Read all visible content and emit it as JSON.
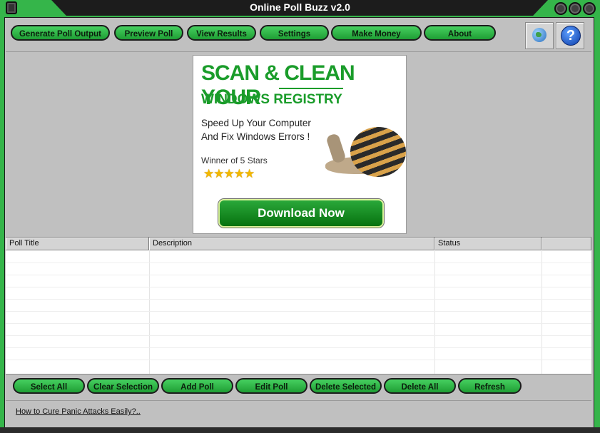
{
  "window": {
    "title": "Online Poll Buzz v2.0"
  },
  "toolbar": {
    "buttons": [
      "Generate Poll Output",
      "Preview Poll",
      "View Results",
      "Settings",
      "Make Money",
      "About"
    ],
    "icons": [
      "globe-icon",
      "help-icon"
    ]
  },
  "ad": {
    "headline": "SCAN & CLEAN YOUR",
    "subheadline": "WINDOWS REGISTRY",
    "line1": "Speed Up Your Computer",
    "line2": "And Fix Windows Errors !",
    "winner": "Winner of 5 Stars",
    "stars": "★★★★★",
    "stars_rating": 5,
    "download_label": "Download Now"
  },
  "table": {
    "columns": [
      "Poll Title",
      "Description",
      "Status",
      ""
    ],
    "rows": []
  },
  "actions": {
    "buttons": [
      "Select All",
      "Clear Selection",
      "Add Poll",
      "Edit Poll",
      "Delete Selected",
      "Delete All",
      "Refresh"
    ]
  },
  "footer": {
    "link": "How to Cure Panic Attacks Easily?.."
  },
  "colors": {
    "accent": "#35b54a",
    "button_green": "#2fb846",
    "ad_green": "#1a9c2a"
  }
}
